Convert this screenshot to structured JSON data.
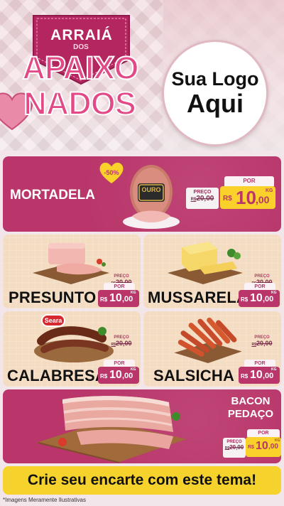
{
  "header": {
    "event_logo_line1": "ARRAIÁ",
    "event_logo_line2": "DOS",
    "event_logo_line3": "APAIXO",
    "event_logo_line4": "NADOS",
    "store_logo_line1": "Sua Logo",
    "store_logo_line2": "Aqui"
  },
  "products": [
    {
      "name": "MORTADELA",
      "discount": "-50%",
      "brand": "OURO",
      "old_label": "PREÇO",
      "old_currency": "R$",
      "old_price": "20,00",
      "por_label": "POR",
      "currency": "R$",
      "price_int": "10",
      "price_dec": ",00",
      "unit": "KG"
    },
    {
      "name": "PRESUNTO",
      "old_label": "PREÇO",
      "old_currency": "R$",
      "old_price": "20,00",
      "por_label": "POR",
      "currency": "R$",
      "price_int": "10",
      "price_dec": ",00",
      "unit": "KG"
    },
    {
      "name": "MUSSARELA",
      "old_label": "PREÇO",
      "old_currency": "R$",
      "old_price": "20,00",
      "por_label": "POR",
      "currency": "R$",
      "price_int": "10",
      "price_dec": ",00",
      "unit": "KG"
    },
    {
      "name": "CALABRESA",
      "brand": "Seara",
      "old_label": "PREÇO",
      "old_currency": "R$",
      "old_price": "20,00",
      "por_label": "POR",
      "currency": "R$",
      "price_int": "10",
      "price_dec": ",00",
      "unit": "KG"
    },
    {
      "name": "SALSICHA",
      "old_label": "PREÇO",
      "old_currency": "R$",
      "old_price": "20,00",
      "por_label": "POR",
      "currency": "R$",
      "price_int": "10",
      "price_dec": ",00",
      "unit": "KG"
    },
    {
      "name_line1": "BACON",
      "name_line2": "PEDAÇO",
      "old_label": "PREÇO",
      "old_currency": "R$",
      "old_price": "20,00",
      "por_label": "POR",
      "currency": "R$",
      "price_int": "10",
      "price_dec": ",00",
      "unit": "KG"
    }
  ],
  "cta": "Crie seu encarte com este tema!",
  "footnote": "*Imagens Meramente Ilustrativas",
  "colors": {
    "pink": "#b9356a",
    "yellow": "#f9d12a",
    "cream": "#f3dcc2"
  }
}
